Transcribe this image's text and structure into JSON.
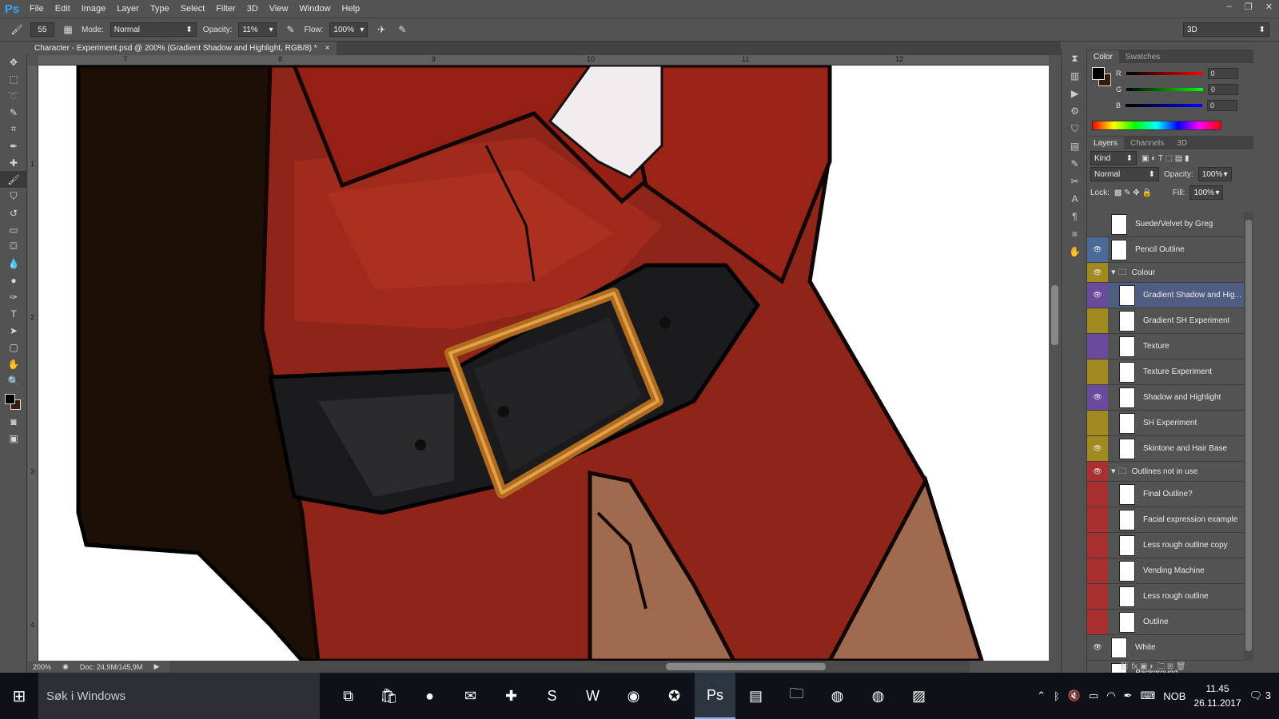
{
  "app": {
    "logo": "Ps",
    "menu": [
      "File",
      "Edit",
      "Image",
      "Layer",
      "Type",
      "Select",
      "Filter",
      "3D",
      "View",
      "Window",
      "Help"
    ],
    "window_controls": [
      "–",
      "❐",
      "✕"
    ]
  },
  "options_bar": {
    "brush_size": "55",
    "mode_label": "Mode:",
    "mode_value": "Normal",
    "opacity_label": "Opacity:",
    "opacity_value": "11%",
    "flow_label": "Flow:",
    "flow_value": "100%",
    "workspace": "3D"
  },
  "document": {
    "tab_title": "Character - Experiment.psd @ 200% (Gradient Shadow and Highlight, RGB/8) *",
    "close": "×",
    "ruler_h": [
      "7",
      "8",
      "9",
      "10",
      "11",
      "12"
    ],
    "ruler_v": [
      "1",
      "2",
      "3",
      "4"
    ],
    "zoom": "200%",
    "doc_size": "Doc: 24,9M/145,9M"
  },
  "color_panel": {
    "tabs": [
      "Color",
      "Swatches"
    ],
    "channels": [
      {
        "label": "R",
        "value": "0",
        "color": "#d32626"
      },
      {
        "label": "G",
        "value": "0",
        "color": "#22b14c"
      },
      {
        "label": "B",
        "value": "0",
        "color": "#2a4fd8"
      }
    ]
  },
  "layers_panel": {
    "tabs": [
      "Layers",
      "Channels",
      "3D"
    ],
    "filter": "Kind",
    "blend_mode": "Normal",
    "opacity_label": "Opacity:",
    "opacity_value": "100%",
    "lock_label": "Lock:",
    "fill_label": "Fill:",
    "fill_value": "100%",
    "layers": [
      {
        "name": "Suede/Velvet by Greg",
        "visible": false,
        "color": "#535353",
        "indent": 0,
        "group": false,
        "selected": false
      },
      {
        "name": "Pencil Outline",
        "visible": true,
        "color": "#4a6a9a",
        "indent": 0,
        "group": false,
        "selected": false
      },
      {
        "name": "Colour",
        "visible": true,
        "color": "#a08a20",
        "indent": 0,
        "group": true,
        "selected": false
      },
      {
        "name": "Gradient Shadow and Hig...",
        "visible": true,
        "color": "#6a4a9a",
        "indent": 1,
        "group": false,
        "selected": true
      },
      {
        "name": "Gradient SH Experiment",
        "visible": false,
        "color": "#a08a20",
        "indent": 1,
        "group": false,
        "selected": false
      },
      {
        "name": "Texture",
        "visible": false,
        "color": "#6a4a9a",
        "indent": 1,
        "group": false,
        "selected": false
      },
      {
        "name": "Texture Experiment",
        "visible": false,
        "color": "#a08a20",
        "indent": 1,
        "group": false,
        "selected": false
      },
      {
        "name": "Shadow and Highlight",
        "visible": true,
        "color": "#6a4a9a",
        "indent": 1,
        "group": false,
        "selected": false
      },
      {
        "name": "SH Experiment",
        "visible": false,
        "color": "#a08a20",
        "indent": 1,
        "group": false,
        "selected": false
      },
      {
        "name": "Skintone and Hair Base",
        "visible": true,
        "color": "#a08a20",
        "indent": 1,
        "group": false,
        "selected": false
      },
      {
        "name": "Outlines not in use",
        "visible": true,
        "color": "#a83030",
        "indent": 0,
        "group": true,
        "selected": false
      },
      {
        "name": "Final Outline?",
        "visible": false,
        "color": "#a83030",
        "indent": 1,
        "group": false,
        "selected": false
      },
      {
        "name": "Facial expression example",
        "visible": false,
        "color": "#a83030",
        "indent": 1,
        "group": false,
        "selected": false
      },
      {
        "name": "Less rough outline copy",
        "visible": false,
        "color": "#a83030",
        "indent": 1,
        "group": false,
        "selected": false
      },
      {
        "name": "Vending Machine",
        "visible": false,
        "color": "#a83030",
        "indent": 1,
        "group": false,
        "selected": false
      },
      {
        "name": "Less rough outline",
        "visible": false,
        "color": "#a83030",
        "indent": 1,
        "group": false,
        "selected": false
      },
      {
        "name": "Outline",
        "visible": false,
        "color": "#a83030",
        "indent": 1,
        "group": false,
        "selected": false
      },
      {
        "name": "White",
        "visible": true,
        "color": "#535353",
        "indent": 0,
        "group": false,
        "selected": false
      },
      {
        "name": "Background",
        "visible": false,
        "color": "#535353",
        "indent": 0,
        "group": false,
        "selected": false
      }
    ]
  },
  "taskbar": {
    "search_placeholder": "Søk i Windows",
    "apps": [
      {
        "name": "task-view",
        "glyph": "⧉",
        "active": false
      },
      {
        "name": "store",
        "glyph": "🛍",
        "active": false
      },
      {
        "name": "spotify",
        "glyph": "●",
        "active": false
      },
      {
        "name": "messenger",
        "glyph": "✉",
        "active": false
      },
      {
        "name": "app-plus",
        "glyph": "✚",
        "active": false
      },
      {
        "name": "skype",
        "glyph": "S",
        "active": false
      },
      {
        "name": "word",
        "glyph": "W",
        "active": false
      },
      {
        "name": "app-globe",
        "glyph": "◉",
        "active": false
      },
      {
        "name": "app-star",
        "glyph": "✪",
        "active": false
      },
      {
        "name": "photoshop",
        "glyph": "Ps",
        "active": true
      },
      {
        "name": "sticky-notes",
        "glyph": "▤",
        "active": false
      },
      {
        "name": "file-explorer",
        "glyph": "🗀",
        "active": false
      },
      {
        "name": "chrome",
        "glyph": "◍",
        "active": false
      },
      {
        "name": "chrome-2",
        "glyph": "◍",
        "active": false
      },
      {
        "name": "photos",
        "glyph": "▨",
        "active": false
      }
    ],
    "language": "NOB",
    "time": "11.45",
    "date": "26.11.2017",
    "notifications": "3"
  }
}
